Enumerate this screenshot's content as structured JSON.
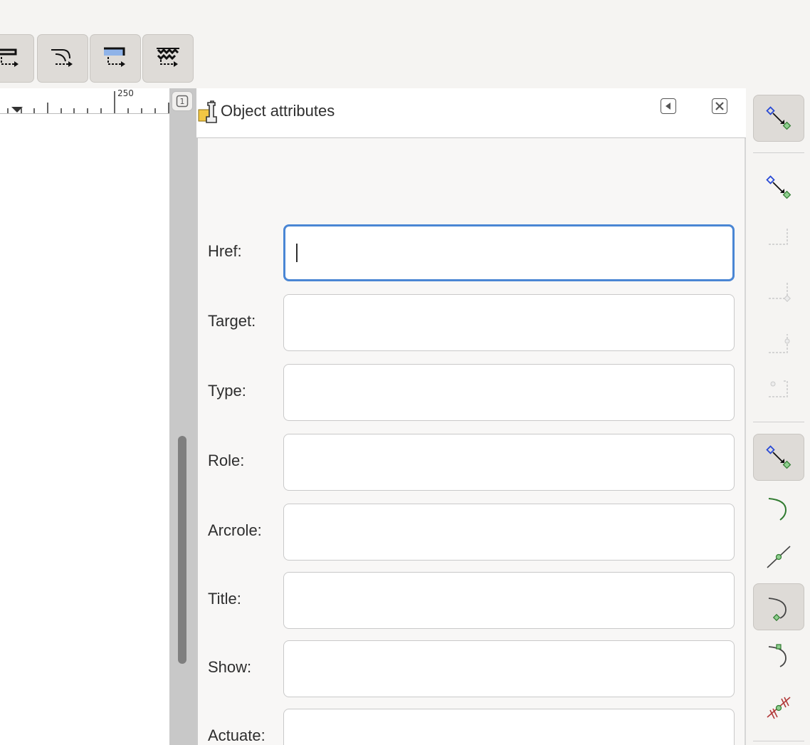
{
  "ruler": {
    "label": "250"
  },
  "corner": {
    "label": "1"
  },
  "dialog": {
    "title": "Object attributes"
  },
  "fields": [
    {
      "label": "Href:",
      "value": ""
    },
    {
      "label": "Target:",
      "value": ""
    },
    {
      "label": "Type:",
      "value": ""
    },
    {
      "label": "Role:",
      "value": ""
    },
    {
      "label": "Arcrole:",
      "value": ""
    },
    {
      "label": "Title:",
      "value": ""
    },
    {
      "label": "Show:",
      "value": ""
    },
    {
      "label": "Actuate:",
      "value": ""
    }
  ],
  "colors": {
    "focus": "#4a86d4",
    "node_blue": "#2a4bd6",
    "node_green": "#5aa65a",
    "curve_green": "#2f7a2f",
    "break_red": "#b23a3a"
  }
}
